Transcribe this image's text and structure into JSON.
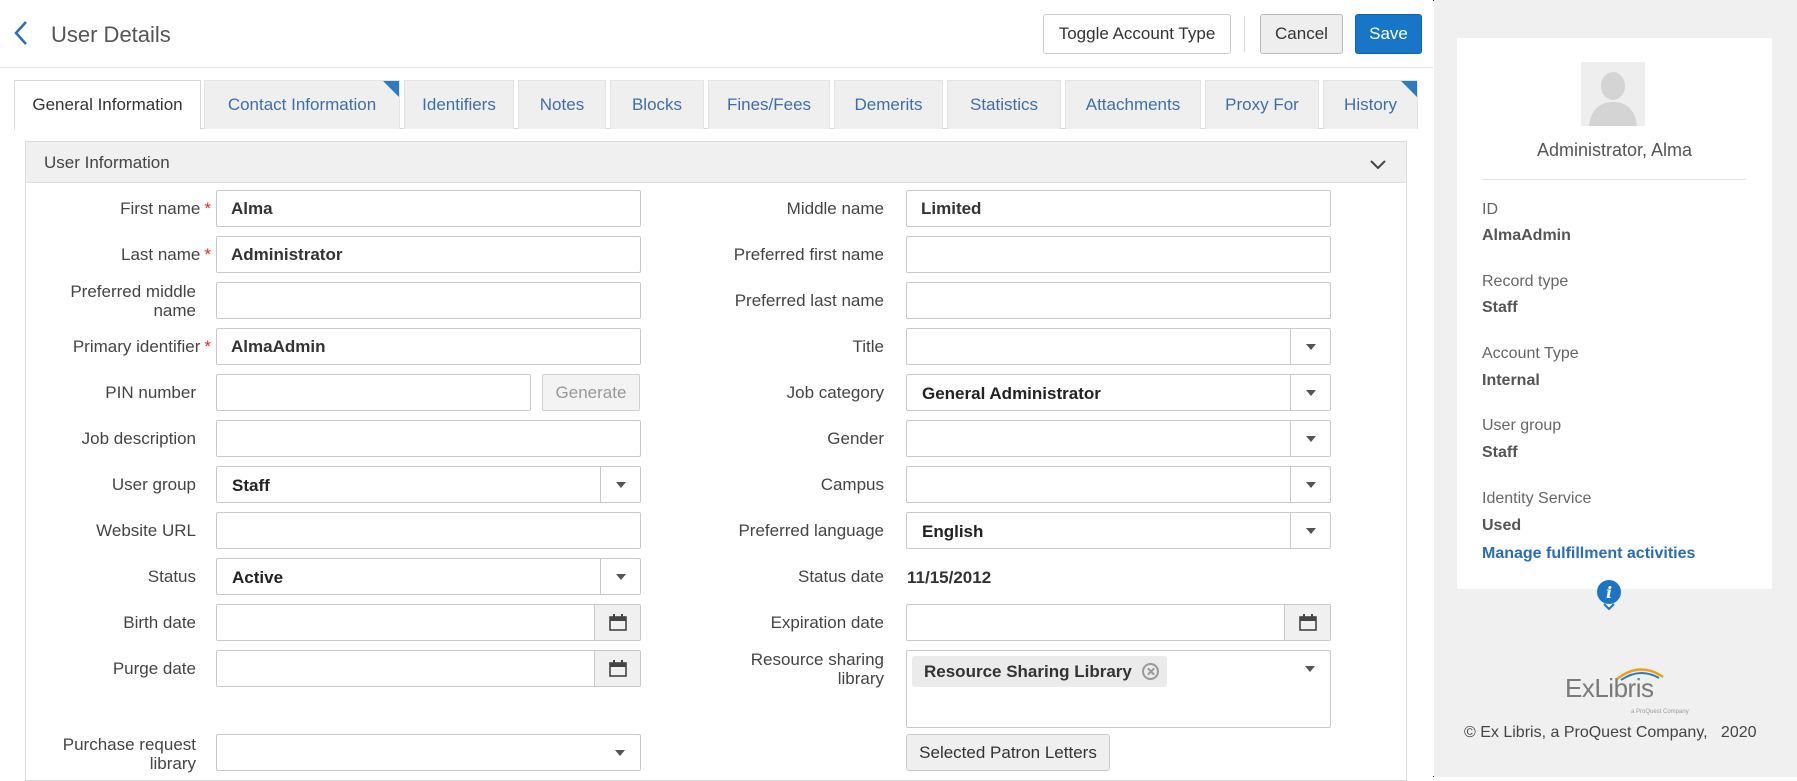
{
  "header": {
    "title": "User Details",
    "toggle_label": "Toggle Account Type",
    "cancel_label": "Cancel",
    "save_label": "Save"
  },
  "tabs": [
    {
      "label": "General Information",
      "active": true
    },
    {
      "label": "Contact Information",
      "marked": true
    },
    {
      "label": "Identifiers"
    },
    {
      "label": "Notes"
    },
    {
      "label": "Blocks"
    },
    {
      "label": "Fines/Fees"
    },
    {
      "label": "Demerits"
    },
    {
      "label": "Statistics"
    },
    {
      "label": "Attachments"
    },
    {
      "label": "Proxy For"
    },
    {
      "label": "History",
      "marked": true
    }
  ],
  "section": {
    "title": "User Information"
  },
  "form": {
    "left": {
      "first_name": {
        "label": "First name",
        "value": "Alma"
      },
      "last_name": {
        "label": "Last name",
        "value": "Administrator"
      },
      "preferred_middle_name": {
        "label": "Preferred middle name",
        "value": ""
      },
      "primary_identifier": {
        "label": "Primary identifier",
        "value": "AlmaAdmin"
      },
      "pin_number": {
        "label": "PIN number",
        "value": "",
        "generate_label": "Generate"
      },
      "job_description": {
        "label": "Job description",
        "value": ""
      },
      "user_group": {
        "label": "User group",
        "value": "Staff"
      },
      "website_url": {
        "label": "Website URL",
        "value": ""
      },
      "status": {
        "label": "Status",
        "value": "Active"
      },
      "birth_date": {
        "label": "Birth date",
        "value": ""
      },
      "purge_date": {
        "label": "Purge date",
        "value": ""
      },
      "purchase_request_library": {
        "label": "Purchase request library",
        "value": ""
      }
    },
    "right": {
      "middle_name": {
        "label": "Middle name",
        "value": "Limited"
      },
      "preferred_first_name": {
        "label": "Preferred first name",
        "value": ""
      },
      "preferred_last_name": {
        "label": "Preferred last name",
        "value": ""
      },
      "title": {
        "label": "Title",
        "value": ""
      },
      "job_category": {
        "label": "Job category",
        "value": "General Administrator"
      },
      "gender": {
        "label": "Gender",
        "value": ""
      },
      "campus": {
        "label": "Campus",
        "value": ""
      },
      "preferred_language": {
        "label": "Preferred language",
        "value": "English"
      },
      "status_date": {
        "label": "Status date",
        "value": "11/15/2012"
      },
      "expiration_date": {
        "label": "Expiration date",
        "value": ""
      },
      "resource_sharing_library": {
        "label": "Resource sharing library",
        "chip": "Resource Sharing Library"
      },
      "patron_letters_label": "Selected Patron Letters"
    }
  },
  "side_panel": {
    "name": "Administrator, Alma",
    "id_label": "ID",
    "id_value": "AlmaAdmin",
    "record_type_label": "Record type",
    "record_type_value": "Staff",
    "account_type_label": "Account Type",
    "account_type_value": "Internal",
    "user_group_label": "User group",
    "user_group_value": "Staff",
    "identity_service_label": "Identity Service",
    "identity_service_value": "Used",
    "link_label": "Manage fulfillment activities",
    "info_glyph": "i"
  },
  "footer": {
    "logo_text": "ExLibris",
    "logo_sub": "a ProQuest Company",
    "copyright": "© Ex Libris, a ProQuest Company,   2020"
  },
  "colors": {
    "accent": "#1776c8",
    "link": "#2a6db5",
    "required": "#d32f2f"
  }
}
